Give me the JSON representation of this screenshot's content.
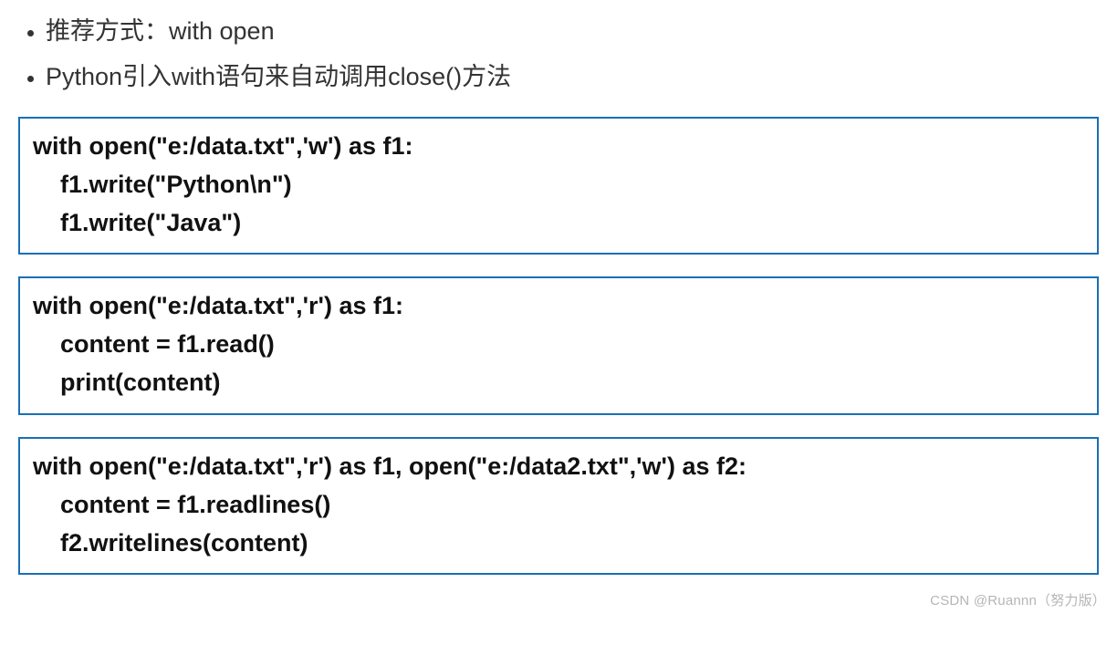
{
  "bullets": [
    "推荐方式：with open",
    "Python引入with语句来自动调用close()方法"
  ],
  "code_blocks": [
    "with open(\"e:/data.txt\",'w') as f1:\n    f1.write(\"Python\\n\")\n    f1.write(\"Java\")",
    "with open(\"e:/data.txt\",'r') as f1:\n    content = f1.read()\n    print(content)",
    "with open(\"e:/data.txt\",'r') as f1, open(\"e:/data2.txt\",'w') as f2:\n    content = f1.readlines()\n    f2.writelines(content)"
  ],
  "watermark": "CSDN @Ruannn（努力版）"
}
